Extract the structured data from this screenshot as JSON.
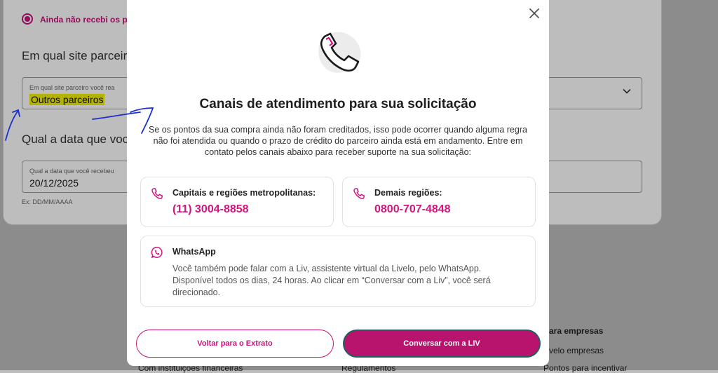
{
  "background": {
    "radio_label": "Ainda não recebi os po",
    "question_site": "Em qual site parceir",
    "field_site": {
      "label": "Em qual site parceiro você rea",
      "value": "Outros parceiros"
    },
    "question_date": "Qual a data que voc",
    "field_date": {
      "label": "Qual a data que você recebeu",
      "value": "20/12/2025"
    },
    "date_hint": "Ex: DD/MM/AAAA",
    "footer": {
      "col1": "Com instituições financeiras",
      "col2": "Regulamentos",
      "col3_title": "ara empresas",
      "col3_item1": "velo empresas",
      "col3_item2": "Pontos para incentivar"
    }
  },
  "modal": {
    "title": "Canais de atendimento para sua solicitação",
    "description": "Se os pontos da sua compra ainda não foram creditados, isso pode ocorrer quando alguma regra não foi atendida ou quando o prazo de crédito do parceiro ainda está em andamento. Entre em contato pelos canais abaixo para receber suporte na sua solicitação:",
    "contacts": [
      {
        "title": "Capitais e regiões metropolitanas:",
        "phone": "(11) 3004-8858"
      },
      {
        "title": "Demais regiões:",
        "phone": "0800-707-4848"
      }
    ],
    "whatsapp": {
      "title": "WhatsApp",
      "text": "Você também pode falar com a Liv, assistente virtual da Livelo, pelo WhatsApp. Disponível todos os dias, 24 horas. Ao clicar em “Conversar com a Liv”, você será direcionado."
    },
    "buttons": {
      "back": "Voltar para o Extrato",
      "chat": "Conversar com a LIV"
    }
  },
  "colors": {
    "accent": "#c4147a",
    "phone": "#d4147e",
    "button_fill": "#b8136d",
    "highlight": "#f2f200"
  }
}
